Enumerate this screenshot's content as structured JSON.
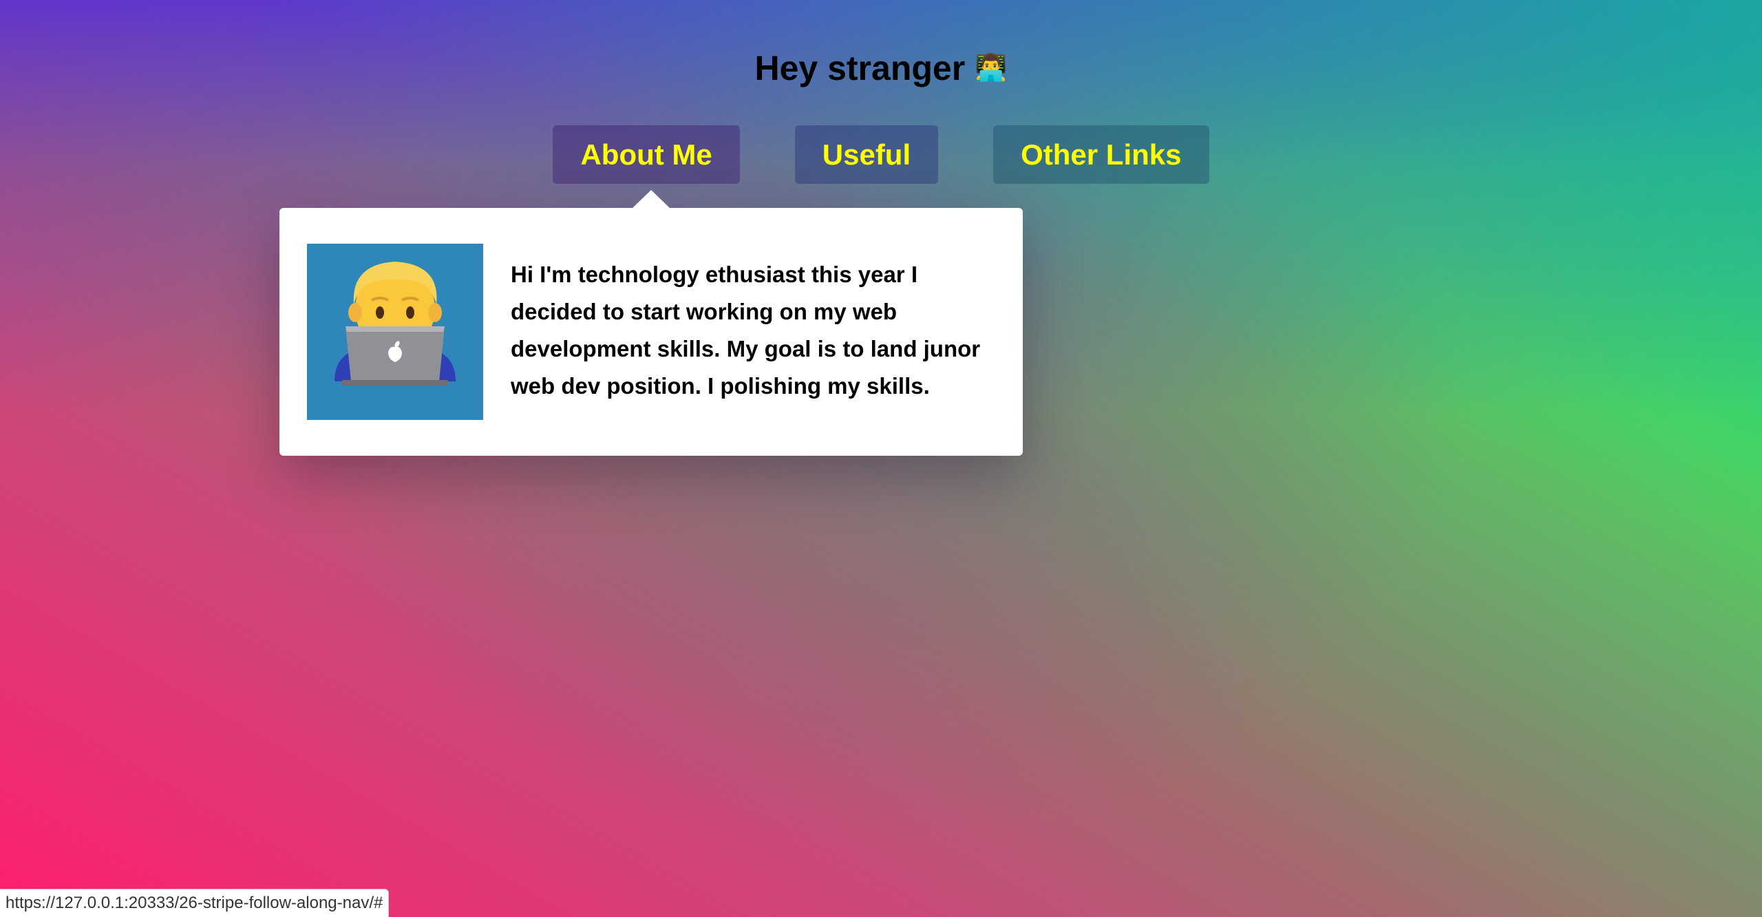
{
  "page": {
    "heading": "Hey stranger",
    "heading_emoji": "👨‍💻"
  },
  "nav": {
    "items": [
      {
        "label": "About Me"
      },
      {
        "label": "Useful"
      },
      {
        "label": "Other Links"
      }
    ]
  },
  "dropdown": {
    "avatar_icon": "technologist-emoji",
    "bio": "Hi I'm technology ethusiast this year I decided to start working on my web development skills. My goal is to land junor web dev position. I polishing my skills."
  },
  "status_bar": {
    "url": "https://127.0.0.1:20333/26-stripe-follow-along-nav/#"
  },
  "colors": {
    "nav_text": "#ffff00",
    "avatar_bg": "#2f86b8",
    "heading": "#000000"
  }
}
